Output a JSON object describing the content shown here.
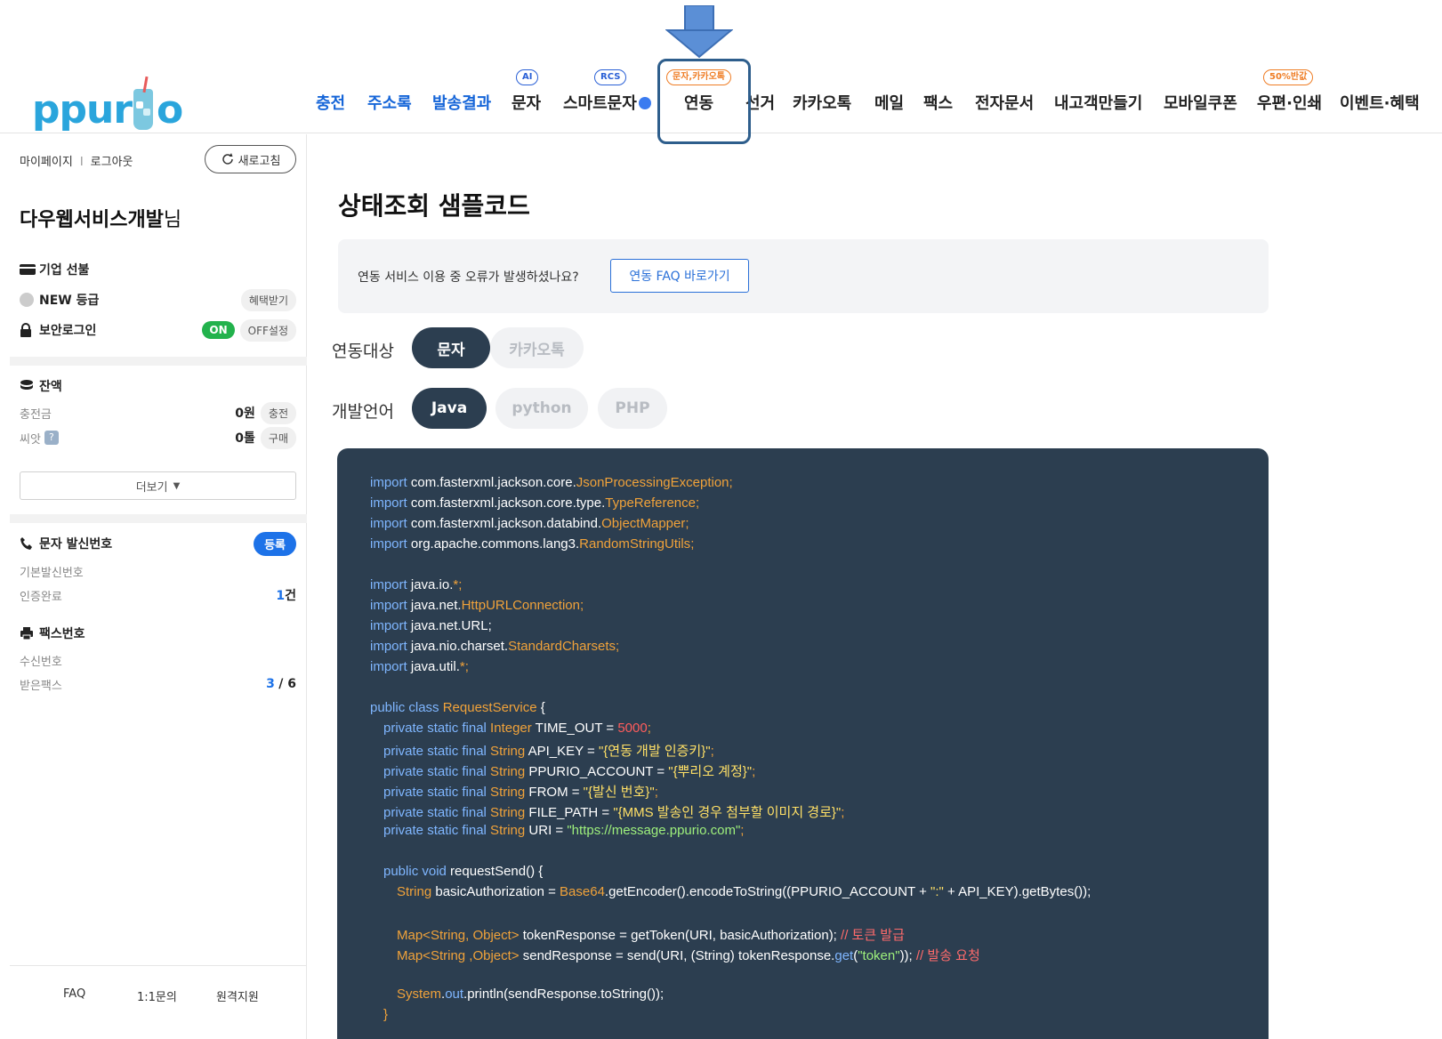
{
  "header": {
    "logo_text_a": "ppur",
    "logo_text_b": "o",
    "nav": [
      {
        "label": "충전",
        "badge": ""
      },
      {
        "label": "주소록",
        "badge": ""
      },
      {
        "label": "발송결과",
        "badge": ""
      },
      {
        "label": "문자",
        "badge": "AI"
      },
      {
        "label": "스마트문자",
        "badge": "RCS"
      },
      {
        "label": "연동",
        "badge": "문자,카카오톡"
      },
      {
        "label": "선거",
        "badge": ""
      },
      {
        "label": "카카오톡",
        "badge": ""
      },
      {
        "label": "메일",
        "badge": ""
      },
      {
        "label": "팩스",
        "badge": ""
      },
      {
        "label": "전자문서",
        "badge": ""
      },
      {
        "label": "내고객만들기",
        "badge": ""
      },
      {
        "label": "모바일쿠폰",
        "badge": ""
      },
      {
        "label": "우편·인쇄",
        "badge": "50%반값"
      },
      {
        "label": "이벤트·혜택",
        "badge": ""
      }
    ]
  },
  "sidebar": {
    "mypage": "마이페이지",
    "divider": "I",
    "logout": "로그아웃",
    "refresh": "새로고침",
    "user_name": "다우웹서비스개발",
    "user_suffix": "님",
    "corp_prepaid": "기업 선불",
    "grade": "NEW 등급",
    "grade_benefit": "혜택받기",
    "secure_login": "보안로그인",
    "secure_on": "ON",
    "secure_off": "OFF설정",
    "balance_title": "잔액",
    "charge_label": "충전금",
    "charge_value": "0원",
    "charge_btn": "충전",
    "seed_label": "씨앗",
    "seed_help": "?",
    "seed_value": "0톨",
    "seed_btn": "구매",
    "more": "더보기",
    "sender_title": "문자 발신번호",
    "sender_register": "등록",
    "sender_default": "기본발신번호",
    "sender_verified": "인증완료",
    "sender_count_num": "1",
    "sender_count_unit": "건",
    "fax_title": "팩스번호",
    "fax_receive": "수신번호",
    "fax_received": "받은팩스",
    "fax_count_a": "3",
    "fax_count_b": "/ 6",
    "footer": [
      "FAQ",
      "1:1문의",
      "원격지원"
    ]
  },
  "main": {
    "title": "상태조회 샘플코드",
    "notice_text": "연동 서비스 이용 중 오류가 발생하셨나요?",
    "faq_button": "연동 FAQ 바로가기",
    "target_label": "연동대상",
    "targets": [
      "문자",
      "카카오톡"
    ],
    "lang_label": "개발언어",
    "langs": [
      "Java",
      "python",
      "PHP"
    ]
  },
  "code": {
    "l1": [
      "import",
      " com.fasterxml.jackson.core.",
      "JsonProcessingException",
      ";"
    ],
    "l2": [
      "import",
      " com.fasterxml.jackson.core.type.",
      "TypeReference",
      ";"
    ],
    "l3": [
      "import",
      " com.fasterxml.jackson.databind.",
      "ObjectMapper",
      ";"
    ],
    "l4": [
      "import",
      " org.apache.commons.lang3.",
      "RandomStringUtils",
      ";"
    ],
    "l5": [
      "import",
      " java.io.",
      "*",
      ";"
    ],
    "l6": [
      "import",
      " java.net.",
      "HttpURLConnection",
      ";"
    ],
    "l7": [
      "import",
      " java.net.URL;"
    ],
    "l8": [
      "import",
      " java.nio.charset.",
      "StandardCharsets",
      ";"
    ],
    "l9": [
      "import",
      " java.util.",
      "*",
      ";"
    ],
    "l10": [
      "public class",
      " ",
      "RequestService",
      " {"
    ],
    "l11": [
      "private static final",
      " Integer",
      " TIME_OUT = ",
      "5000",
      ";"
    ],
    "l12": [
      "private static final",
      " String",
      " API_KEY = ",
      "\"{연동 개발 인증키}\"",
      ";"
    ],
    "l13": [
      "private static final",
      " String",
      " PPURIO_ACCOUNT = ",
      "\"{뿌리오 계정}\"",
      ";"
    ],
    "l14": [
      "private static final",
      " String",
      " FROM = ",
      "\"{발신 번호}\"",
      ";"
    ],
    "l15": [
      "private static final",
      " String",
      " FILE_PATH = ",
      "\"{MMS 발송인 경우 첨부할 이미지 경로}\"",
      ";"
    ],
    "l16": [
      "private static final",
      " String",
      " URI = ",
      "\"https://message.ppurio.com\"",
      ";"
    ],
    "l17": [
      "public void",
      " requestSend() {"
    ],
    "l18": [
      "String",
      " basicAuthorization = ",
      "Base64",
      ".getEncoder().encodeToString((PPURIO_ACCOUNT + ",
      "\":\"",
      " + API_KEY).getBytes());"
    ],
    "l19": [
      "Map<String, Object>",
      " tokenResponse = getToken(URI, basicAuthorization); ",
      "// 토큰 발급"
    ],
    "l20": [
      "Map<String ,Object>",
      " sendResponse = send(URI, (String) tokenResponse.",
      "get",
      "(",
      "\"token\"",
      ")); ",
      "// 발송 요청"
    ],
    "l21": [
      "System",
      ".",
      "out",
      ".println(sendResponse.toString());"
    ],
    "l22": [
      "}"
    ]
  }
}
